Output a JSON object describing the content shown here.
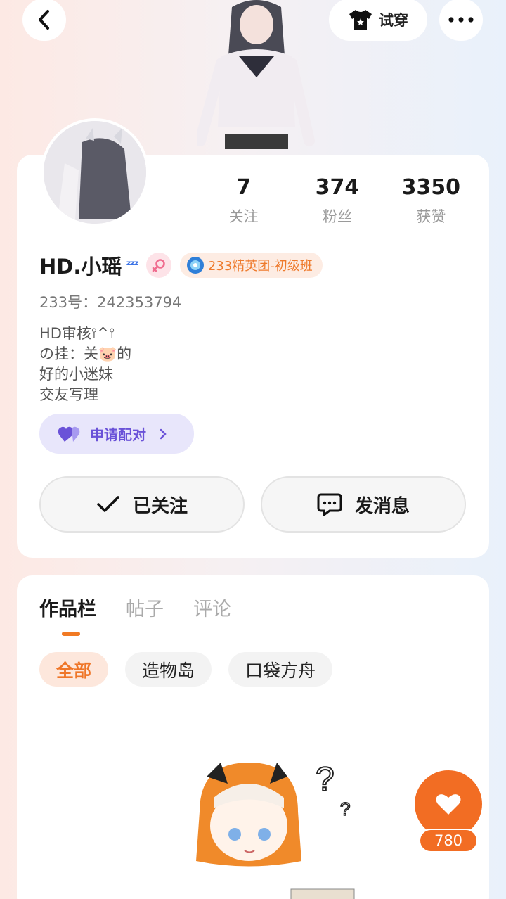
{
  "header": {
    "tryon_label": "试穿"
  },
  "profile": {
    "stats": [
      {
        "value": "7",
        "label": "关注"
      },
      {
        "value": "374",
        "label": "粉丝"
      },
      {
        "value": "3350",
        "label": "获赞"
      }
    ],
    "username": "HD.小瑶",
    "rank_badge": "233精英团-初级班",
    "uid_text": "233号：242353794",
    "bio_lines": [
      "HD审核⟟^⟟",
      "の挂：关🐷的",
      "好的小迷妹",
      "交友写理"
    ],
    "pair_label": "申请配对",
    "followed_label": "已关注",
    "message_label": "发消息"
  },
  "works": {
    "tabs": [
      "作品栏",
      "帖子",
      "评论"
    ],
    "filters": [
      "全部",
      "造物岛",
      "口袋方舟"
    ]
  },
  "like": {
    "count": "780"
  },
  "colors": {
    "accent": "#f26d23",
    "pair": "#6a52d8"
  }
}
